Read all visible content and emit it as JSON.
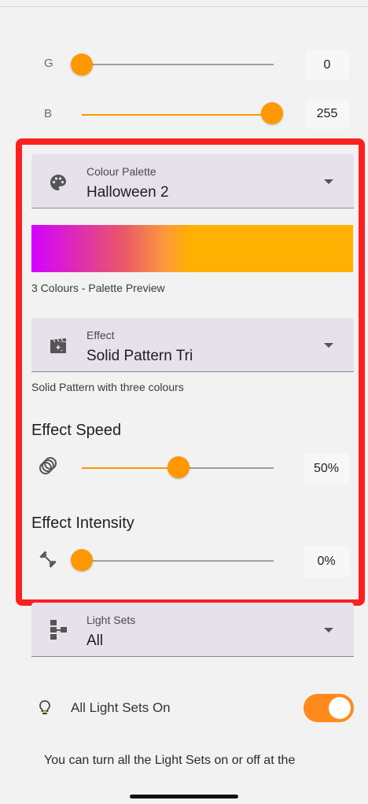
{
  "rgb": {
    "g": {
      "label": "G",
      "value": "0",
      "fraction": 0.0
    },
    "b": {
      "label": "B",
      "value": "255",
      "fraction": 1.0
    }
  },
  "palette": {
    "label": "Colour Palette",
    "value": "Halloween 2",
    "preview_caption": "3 Colours - Palette Preview",
    "colors": [
      "#d400ff",
      "#ff9a3a",
      "#ffb000"
    ]
  },
  "effect": {
    "label": "Effect",
    "value": "Solid Pattern Tri",
    "description": "Solid Pattern with three colours"
  },
  "speed": {
    "title": "Effect Speed",
    "value": "50%",
    "fraction": 0.5
  },
  "intensity": {
    "title": "Effect Intensity",
    "value": "0%",
    "fraction": 0.0
  },
  "light_sets": {
    "label": "Light Sets",
    "value": "All"
  },
  "all_on": {
    "label": "All Light Sets On",
    "enabled": true
  },
  "footer_text": "You can turn all the Light Sets on or off at the",
  "accent_color": "#ff9800",
  "highlight_color": "#ff1f1f"
}
